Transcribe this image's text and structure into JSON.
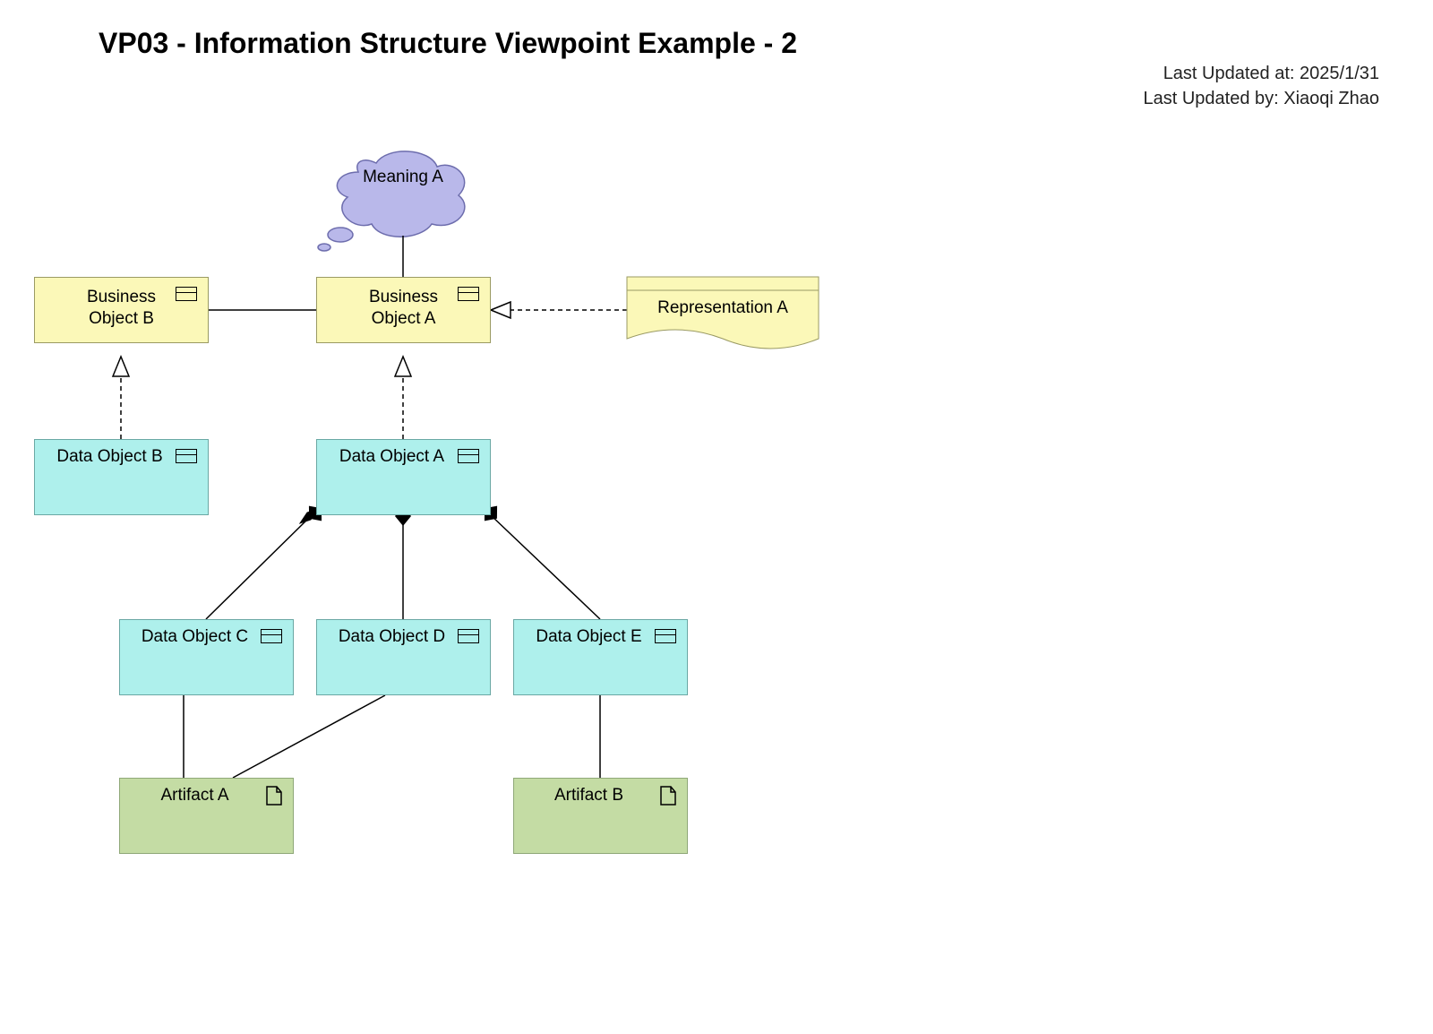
{
  "title": "VP03 - Information Structure Viewpoint Example - 2",
  "meta": {
    "updated_at_label": "Last Updated at: ",
    "updated_at": "2025/1/31",
    "updated_by_label": "Last Updated by: ",
    "updated_by": "Xiaoqi Zhao"
  },
  "nodes": {
    "meaning_a": "Meaning A",
    "business_object_b": "Business\nObject B",
    "business_object_a": "Business\nObject A",
    "representation_a": "Representation A",
    "data_object_b": "Data Object B",
    "data_object_a": "Data Object A",
    "data_object_c": "Data Object C",
    "data_object_d": "Data Object D",
    "data_object_e": "Data Object E",
    "artifact_a": "Artifact A",
    "artifact_b": "Artifact B"
  },
  "colors": {
    "business": "#fbf8b8",
    "data": "#aef0ec",
    "artifact": "#c4dca4",
    "meaning": "#b9b8ea"
  },
  "chart_data": {
    "type": "diagram",
    "notation": "ArchiMate",
    "elements": [
      {
        "id": "meaning_a",
        "type": "Meaning",
        "label": "Meaning A"
      },
      {
        "id": "business_object_a",
        "type": "BusinessObject",
        "label": "Business Object A"
      },
      {
        "id": "business_object_b",
        "type": "BusinessObject",
        "label": "Business Object B"
      },
      {
        "id": "representation_a",
        "type": "Representation",
        "label": "Representation A"
      },
      {
        "id": "data_object_a",
        "type": "DataObject",
        "label": "Data Object A"
      },
      {
        "id": "data_object_b",
        "type": "DataObject",
        "label": "Data Object B"
      },
      {
        "id": "data_object_c",
        "type": "DataObject",
        "label": "Data Object C"
      },
      {
        "id": "data_object_d",
        "type": "DataObject",
        "label": "Data Object D"
      },
      {
        "id": "data_object_e",
        "type": "DataObject",
        "label": "Data Object E"
      },
      {
        "id": "artifact_a",
        "type": "Artifact",
        "label": "Artifact A"
      },
      {
        "id": "artifact_b",
        "type": "Artifact",
        "label": "Artifact B"
      }
    ],
    "relationships": [
      {
        "from": "meaning_a",
        "to": "business_object_a",
        "type": "association"
      },
      {
        "from": "business_object_b",
        "to": "business_object_a",
        "type": "association"
      },
      {
        "from": "representation_a",
        "to": "business_object_a",
        "type": "realization"
      },
      {
        "from": "data_object_b",
        "to": "business_object_b",
        "type": "realization"
      },
      {
        "from": "data_object_a",
        "to": "business_object_a",
        "type": "realization"
      },
      {
        "from": "data_object_c",
        "to": "data_object_a",
        "type": "composition"
      },
      {
        "from": "data_object_d",
        "to": "data_object_a",
        "type": "composition"
      },
      {
        "from": "data_object_e",
        "to": "data_object_a",
        "type": "composition"
      },
      {
        "from": "artifact_a",
        "to": "data_object_c",
        "type": "association"
      },
      {
        "from": "artifact_a",
        "to": "data_object_d",
        "type": "association"
      },
      {
        "from": "artifact_b",
        "to": "data_object_e",
        "type": "association"
      }
    ]
  }
}
